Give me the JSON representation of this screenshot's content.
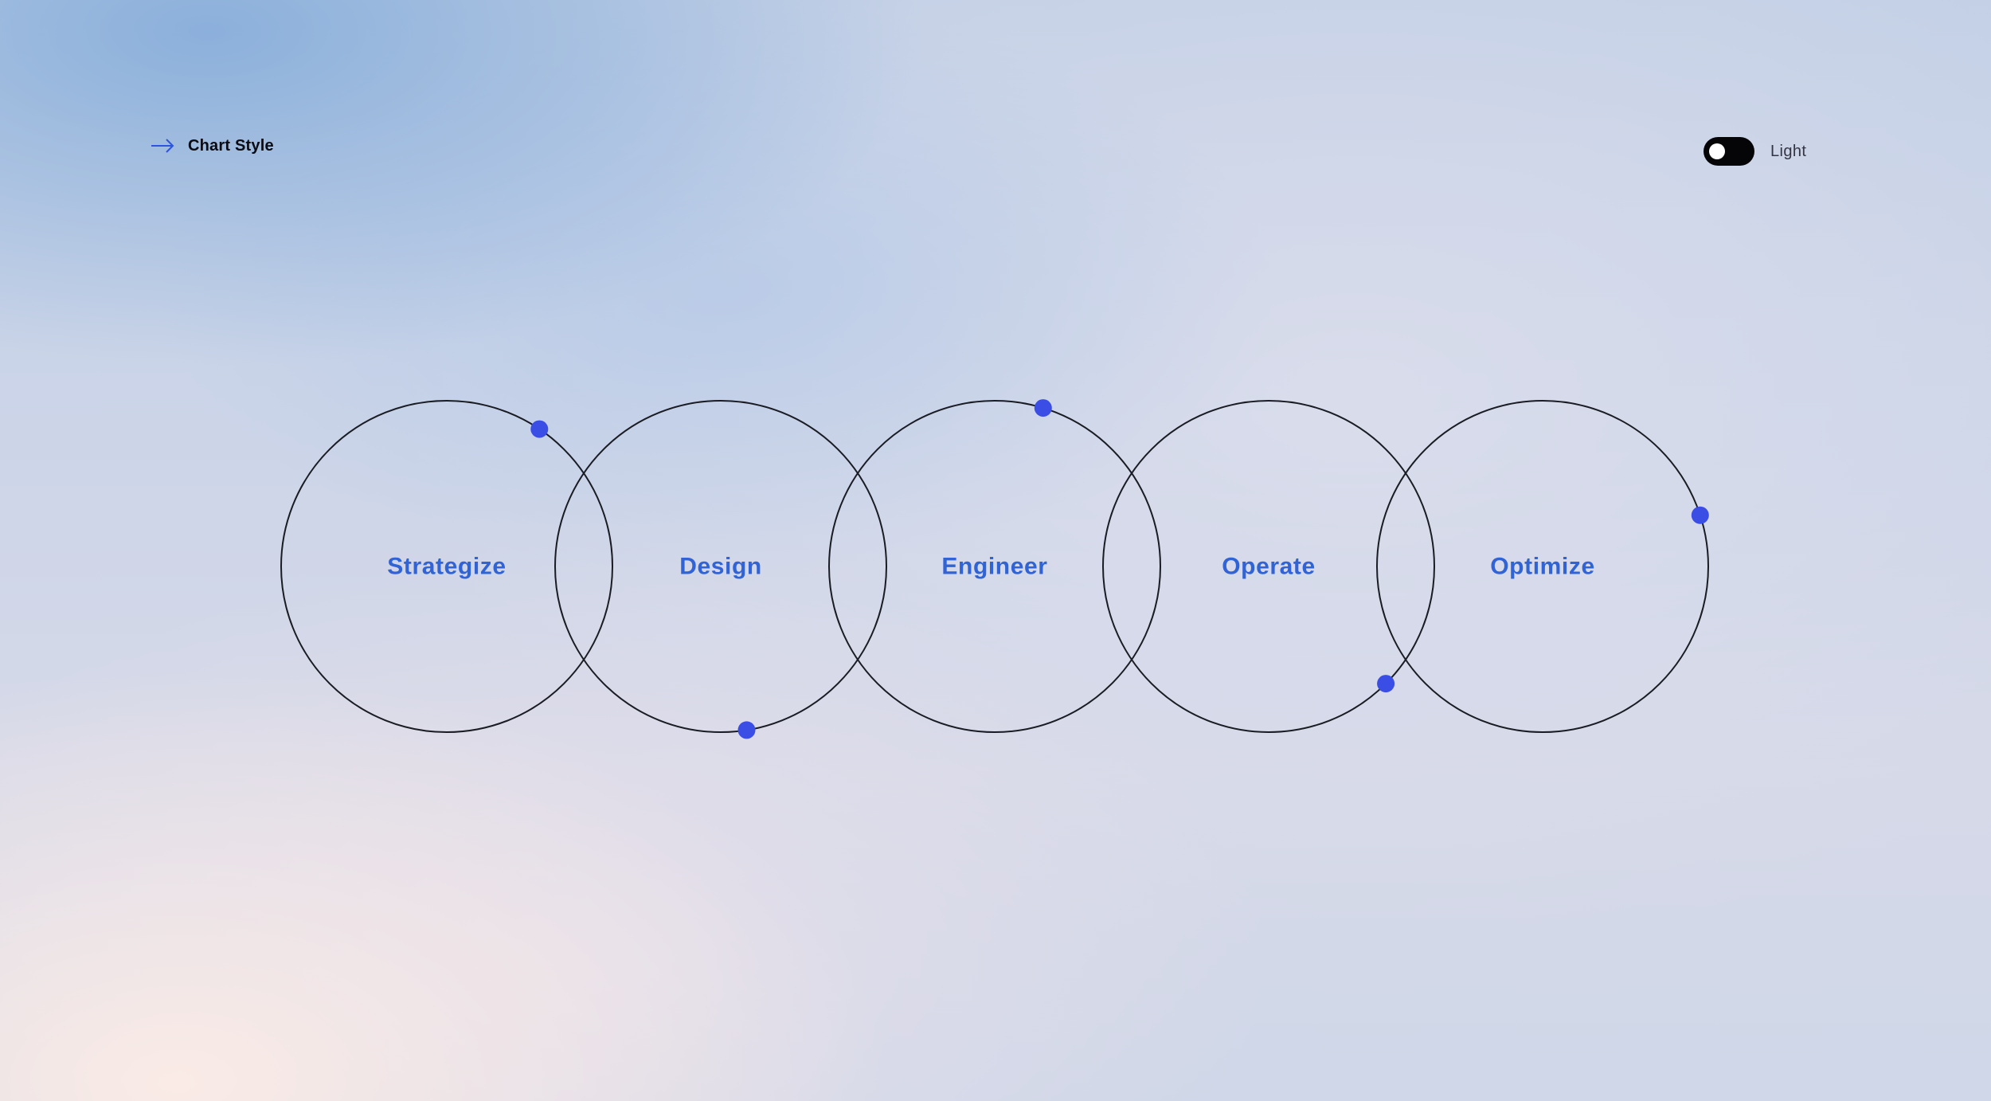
{
  "header": {
    "chart_style_label": "Chart Style",
    "arrow_icon": "arrow-right-icon"
  },
  "theme_toggle": {
    "label": "Light",
    "state": "off"
  },
  "colors": {
    "accent": "#2f63d6",
    "dot": "#3a4ee6",
    "circle_stroke": "#1a1c24"
  },
  "cycle": {
    "stages": [
      {
        "label": "Strategize",
        "marker_angle_deg": -56
      },
      {
        "label": "Design",
        "marker_angle_deg": 81
      },
      {
        "label": "Engineer",
        "marker_angle_deg": -73
      },
      {
        "label": "Operate",
        "marker_angle_deg": 45
      },
      {
        "label": "Optimize",
        "marker_angle_deg": -18
      }
    ]
  }
}
